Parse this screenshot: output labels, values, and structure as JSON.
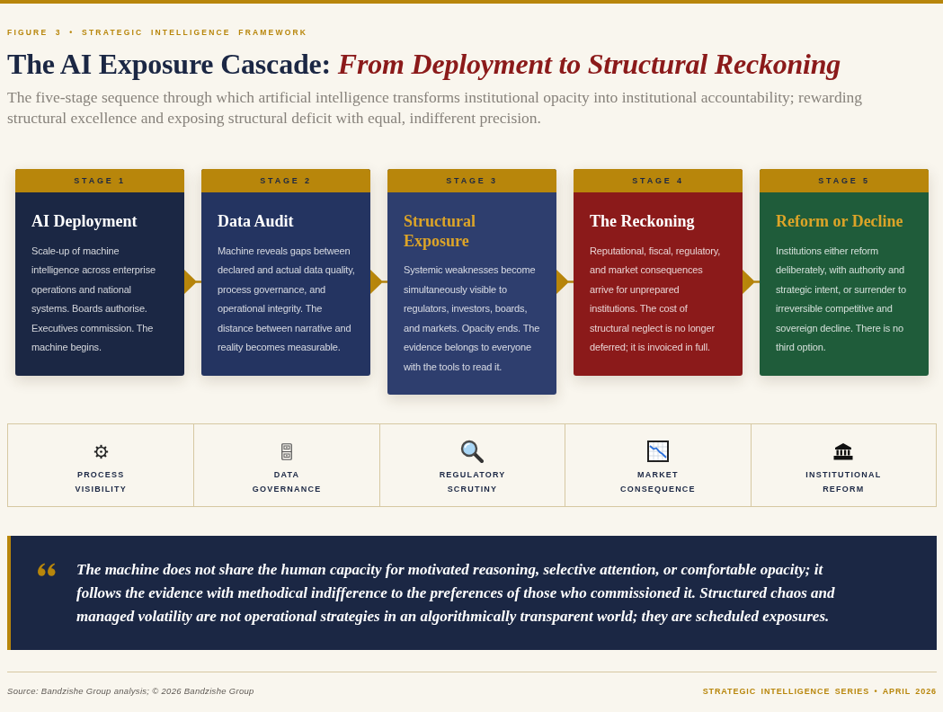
{
  "figure": {
    "eyebrow": "FIGURE 3 • STRATEGIC INTELLIGENCE FRAMEWORK",
    "title": "The AI Exposure Cascade: *From Deployment to Structural Reckoning*",
    "subtitle": "The five-stage sequence through which artificial intelligence transforms institutional opacity into institutional accountability; rewarding structural excellence and exposing structural deficit with equal, indifferent precision."
  },
  "stages": [
    {
      "label": "STAGE 1",
      "title": "AI Deployment",
      "description": "Scale-up of machine intelligence across enterprise operations and national systems. Boards authorise. Executives commission. The machine begins.",
      "color": "#1b2744",
      "accented": false
    },
    {
      "label": "STAGE 2",
      "title": "Data Audit",
      "description": "Machine reveals gaps between declared and actual data quality, process governance, and operational integrity. The distance between narrative and reality becomes measurable.",
      "color": "#243461",
      "accented": false
    },
    {
      "label": "STAGE 3",
      "title": "Structural Exposure",
      "description": "Systemic weaknesses become simultaneously visible to regulators, investors, boards, and markets. Opacity ends. The evidence belongs to everyone with the tools to read it.",
      "color": "#2e3e6e",
      "accented": true
    },
    {
      "label": "STAGE 4",
      "title": "The Reckoning",
      "description": "Reputational, fiscal, regulatory, and market consequences arrive for unprepared institutions. The cost of structural neglect is no longer deferred; it is invoiced in full.",
      "color": "#8b1a1a",
      "accented": false
    },
    {
      "label": "STAGE 5",
      "title": "Reform or Decline",
      "description": "Institutions either reform deliberately, with authority and strategic intent, or surrender to irreversible competitive and sovereign decline. There is no third option.",
      "color": "#1f5c3a",
      "accented": true
    }
  ],
  "themes": [
    {
      "label": "PROCESS VISIBILITY"
    },
    {
      "label": "DATA GOVERNANCE"
    },
    {
      "label": "REGULATORY SCRUTINY"
    },
    {
      "label": "MARKET CONSEQUENCE"
    },
    {
      "label": "INSTITUTIONAL REFORM"
    }
  ],
  "quote": {
    "text": "The machine does not share the human capacity for motivated reasoning, selective attention, or comfortable opacity; it follows the evidence with methodical indifference to the preferences of those who commissioned it. Structured chaos and managed volatility are not operational strategies in an algorithmically transparent world; they are scheduled exposures."
  },
  "footer": {
    "source": "Source: Bandzishe Group analysis; © 2026 Bandzishe Group",
    "series": "STRATEGIC INTELLIGENCE SERIES • APRIL 2026"
  }
}
